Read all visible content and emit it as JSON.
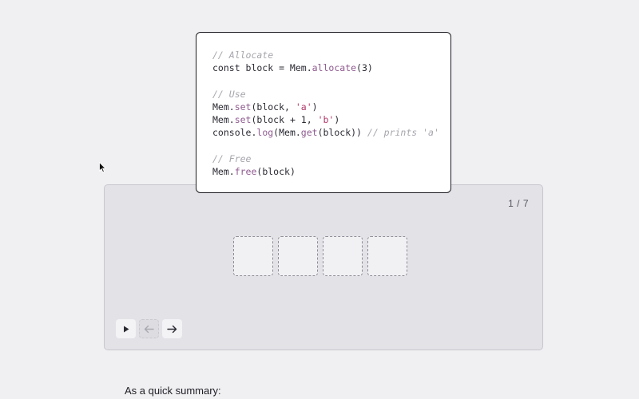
{
  "code_snippet": {
    "lines": [
      [
        {
          "text": "// Allocate",
          "kind": "comment"
        }
      ],
      [
        {
          "text": "const block = Mem.",
          "kind": "plain"
        },
        {
          "text": "allocate",
          "kind": "fn"
        },
        {
          "text": "(3)",
          "kind": "plain"
        }
      ],
      [],
      [
        {
          "text": "// Use",
          "kind": "comment"
        }
      ],
      [
        {
          "text": "Mem.",
          "kind": "plain"
        },
        {
          "text": "set",
          "kind": "fn"
        },
        {
          "text": "(block, ",
          "kind": "plain"
        },
        {
          "text": "'a'",
          "kind": "str"
        },
        {
          "text": ")",
          "kind": "plain"
        }
      ],
      [
        {
          "text": "Mem.",
          "kind": "plain"
        },
        {
          "text": "set",
          "kind": "fn"
        },
        {
          "text": "(block + 1, ",
          "kind": "plain"
        },
        {
          "text": "'b'",
          "kind": "str"
        },
        {
          "text": ")",
          "kind": "plain"
        }
      ],
      [
        {
          "text": "console.",
          "kind": "plain"
        },
        {
          "text": "log",
          "kind": "fn"
        },
        {
          "text": "(Mem.",
          "kind": "plain"
        },
        {
          "text": "get",
          "kind": "fn"
        },
        {
          "text": "(block)) ",
          "kind": "plain"
        },
        {
          "text": "// prints 'a'",
          "kind": "comment"
        }
      ],
      [],
      [
        {
          "text": "// Free",
          "kind": "comment"
        }
      ],
      [
        {
          "text": "Mem.",
          "kind": "plain"
        },
        {
          "text": "free",
          "kind": "fn"
        },
        {
          "text": "(block)",
          "kind": "plain"
        }
      ]
    ]
  },
  "visualization": {
    "step_counter": "1 / 7",
    "memory_cells": [
      "",
      "",
      "",
      ""
    ]
  },
  "controls": {
    "play": {
      "icon": "play-icon",
      "enabled": true
    },
    "back": {
      "icon": "arrow-left-icon",
      "enabled": false
    },
    "forward": {
      "icon": "arrow-right-icon",
      "enabled": true
    }
  },
  "summary_text": "As a quick summary:",
  "colors": {
    "page_background": "#f0f0f2",
    "stage_background": "#e2e2e7",
    "comment": "#a7a5ad",
    "function": "#8f5a8f",
    "string": "#b0386a"
  }
}
